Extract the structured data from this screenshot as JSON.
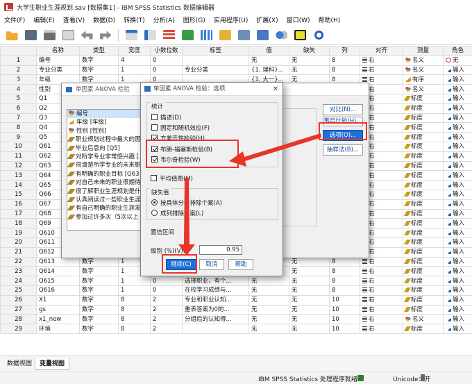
{
  "window": {
    "title": "大学生职业生涯规划.sav [数据集1] - IBM SPSS Statistics 数据编辑器"
  },
  "menu": [
    "文件(F)",
    "编辑(E)",
    "查看(V)",
    "数据(D)",
    "转换(T)",
    "分析(A)",
    "图形(G)",
    "实用程序(U)",
    "扩展(X)",
    "窗口(W)",
    "帮助(H)"
  ],
  "toolbar_icons": [
    "open-folder-icon",
    "save-icon",
    "print-icon",
    "dialog-recall-icon",
    "undo-icon",
    "redo-icon",
    "goto-case-icon",
    "goto-variable-icon",
    "variables-icon",
    "find-icon",
    "insert-cases-icon",
    "insert-variable-icon",
    "split-file-icon",
    "weight-cases-icon",
    "value-labels-icon",
    "use-sets-icon",
    "spelling-icon",
    "search-icon"
  ],
  "grid": {
    "columns": [
      "",
      "名称",
      "类型",
      "宽度",
      "小数位数",
      "标签",
      "值",
      "缺失",
      "列",
      "对齐",
      "测量",
      "角色"
    ],
    "rows": [
      [
        "1",
        "编号",
        "数字",
        "4",
        "0",
        "",
        "无",
        "无",
        "8",
        "右",
        "名义",
        "无"
      ],
      [
        "2",
        "专业分类",
        "数字",
        "1",
        "0",
        "专业分类",
        "{1, 理科}...",
        "无",
        "8",
        "右",
        "名义",
        "输入"
      ],
      [
        "3",
        "年级",
        "数字",
        "1",
        "0",
        "",
        "{1, 大一}...",
        "无",
        "8",
        "右",
        "有序",
        "输入"
      ],
      [
        "4",
        "性别",
        "数字",
        "1",
        "0",
        "",
        "",
        "无",
        "8",
        "右",
        "名义",
        "输入"
      ],
      [
        "5",
        "Q1",
        "数字",
        "1",
        "0",
        "",
        "",
        "无",
        "8",
        "右",
        "标度",
        "输入"
      ],
      [
        "6",
        "Q2",
        "数字",
        "1",
        "0",
        "",
        "",
        "无",
        "8",
        "右",
        "标度",
        "输入"
      ],
      [
        "7",
        "Q3",
        "数字",
        "1",
        "0",
        "",
        "",
        "无",
        "8",
        "右",
        "标度",
        "输入"
      ],
      [
        "8",
        "Q4",
        "数字",
        "1",
        "0",
        "",
        "",
        "无",
        "8",
        "右",
        "标度",
        "输入"
      ],
      [
        "9",
        "Q5",
        "数字",
        "1",
        "0",
        "",
        "",
        "无",
        "8",
        "右",
        "标度",
        "输入"
      ],
      [
        "10",
        "Q61",
        "数字",
        "1",
        "0",
        "",
        "",
        "无",
        "8",
        "右",
        "标度",
        "输入"
      ],
      [
        "11",
        "Q62",
        "数字",
        "1",
        "0",
        "",
        "",
        "无",
        "8",
        "右",
        "标度",
        "输入"
      ],
      [
        "12",
        "Q63",
        "数字",
        "1",
        "0",
        "",
        "",
        "无",
        "8",
        "右",
        "标度",
        "输入"
      ],
      [
        "13",
        "Q64",
        "数字",
        "1",
        "0",
        "",
        "",
        "无",
        "8",
        "右",
        "标度",
        "输入"
      ],
      [
        "14",
        "Q65",
        "数字",
        "1",
        "0",
        "",
        "",
        "无",
        "8",
        "右",
        "标度",
        "输入"
      ],
      [
        "15",
        "Q66",
        "数字",
        "1",
        "0",
        "",
        "",
        "无",
        "8",
        "右",
        "标度",
        "输入"
      ],
      [
        "16",
        "Q67",
        "数字",
        "1",
        "0",
        "",
        "",
        "无",
        "8",
        "右",
        "标度",
        "输入"
      ],
      [
        "17",
        "Q68",
        "数字",
        "1",
        "0",
        "",
        "",
        "无",
        "8",
        "右",
        "标度",
        "输入"
      ],
      [
        "18",
        "Q69",
        "数字",
        "1",
        "0",
        "",
        "",
        "无",
        "8",
        "右",
        "标度",
        "输入"
      ],
      [
        "19",
        "Q610",
        "数字",
        "1",
        "0",
        "",
        "",
        "无",
        "8",
        "右",
        "标度",
        "输入"
      ],
      [
        "20",
        "Q611",
        "数字",
        "1",
        "0",
        "",
        "",
        "无",
        "8",
        "右",
        "标度",
        "输入"
      ],
      [
        "21",
        "Q612",
        "数字",
        "1",
        "0",
        "",
        "",
        "无",
        "8",
        "右",
        "标度",
        "输入"
      ],
      [
        "22",
        "Q613",
        "数字",
        "1",
        "0",
        "",
        "",
        "无",
        "8",
        "右",
        "标度",
        "输入"
      ],
      [
        "23",
        "Q614",
        "数字",
        "1",
        "0",
        "选择职业，择机...",
        "无",
        "无",
        "8",
        "右",
        "标度",
        "输入"
      ],
      [
        "24",
        "Q615",
        "数字",
        "1",
        "0",
        "选择职业，有个...",
        "无",
        "无",
        "8",
        "右",
        "标度",
        "输入"
      ],
      [
        "25",
        "Q616",
        "数字",
        "1",
        "0",
        "在校学习成绩与...",
        "无",
        "无",
        "8",
        "右",
        "标度",
        "输入"
      ],
      [
        "26",
        "X1",
        "数字",
        "8",
        "2",
        "专业和职业认知...",
        "无",
        "无",
        "10",
        "右",
        "标度",
        "输入"
      ],
      [
        "27",
        "gs",
        "数字",
        "8",
        "2",
        "重表答案为0的...",
        "无",
        "无",
        "10",
        "右",
        "标度",
        "输入"
      ],
      [
        "28",
        "x1_new",
        "数字",
        "8",
        "2",
        "分组后的认知得...",
        "无",
        "无",
        "10",
        "右",
        "名义",
        "输入"
      ],
      [
        "29",
        "环境",
        "数字",
        "8",
        "2",
        "",
        "无",
        "无",
        "10",
        "右",
        "标度",
        "输入"
      ]
    ],
    "measure_icons": {
      "名义": "nominal",
      "有序": "ordinal",
      "标度": "scale"
    },
    "role_icons": {
      "无": "none",
      "输入": "input"
    }
  },
  "tabs": {
    "data_view": "数据视图",
    "variable_view": "变量视图"
  },
  "status": {
    "processor": "IBM SPSS Statistics 处理程序就绪",
    "unicode": "Unicode：开"
  },
  "anova_dialog": {
    "title": "单因素 ANOVA 检验",
    "variables": [
      {
        "icon": "nominal",
        "label": "编号"
      },
      {
        "icon": "ordinal",
        "label": "年级 [年级]"
      },
      {
        "icon": "nominal",
        "label": "性别 [性别]"
      },
      {
        "icon": "scale",
        "label": "职业规划过程中最大的困"
      },
      {
        "icon": "scale",
        "label": "毕业后意向 [Q5]"
      },
      {
        "icon": "scale",
        "label": "对所学专业非常感兴趣 ["
      },
      {
        "icon": "scale",
        "label": "很清楚所学专业的未来职"
      },
      {
        "icon": "scale",
        "label": "有明确的职业目标 [Q63"
      },
      {
        "icon": "scale",
        "label": "对自己未来的职业很期待"
      },
      {
        "icon": "scale",
        "label": "很了解职业生涯规划是什"
      },
      {
        "icon": "scale",
        "label": "认真阅读过一些职业生涯"
      },
      {
        "icon": "scale",
        "label": "有自己明确的职业生涯发"
      },
      {
        "icon": "scale",
        "label": "参加过许多次（5次以上"
      }
    ],
    "buttons": {
      "contrasts": "对比(N)...",
      "post_hoc": "事后比较(H)...",
      "options": "选项(O)...",
      "bootstrap": "抽样法(B)..."
    }
  },
  "options_dialog": {
    "title": "单因素 ANOVA 检验：选项",
    "statistics_label": "统计",
    "statistics": [
      {
        "label": "描述(D)",
        "checked": false
      },
      {
        "label": "固定和随机效应(F)",
        "checked": false
      },
      {
        "label": "方差齐性检验(H)",
        "checked": true
      },
      {
        "label": "布朗-福塞斯检验(B)",
        "checked": true
      },
      {
        "label": "韦尔奇检验(W)",
        "checked": true
      }
    ],
    "means_plot": {
      "label": "平均值图(M)",
      "checked": false
    },
    "missing_label": "缺失值",
    "missing": [
      {
        "label": "按具体分析排除个案(A)",
        "selected": true
      },
      {
        "label": "成列排除个案(L)",
        "selected": false
      }
    ],
    "ci_label": "置信区间",
    "ci_level_label": "级别 (%)(V):",
    "ci_level_value": "0.95",
    "buttons": {
      "continue": "继续(C)",
      "cancel": "取消",
      "help": "帮助"
    }
  }
}
